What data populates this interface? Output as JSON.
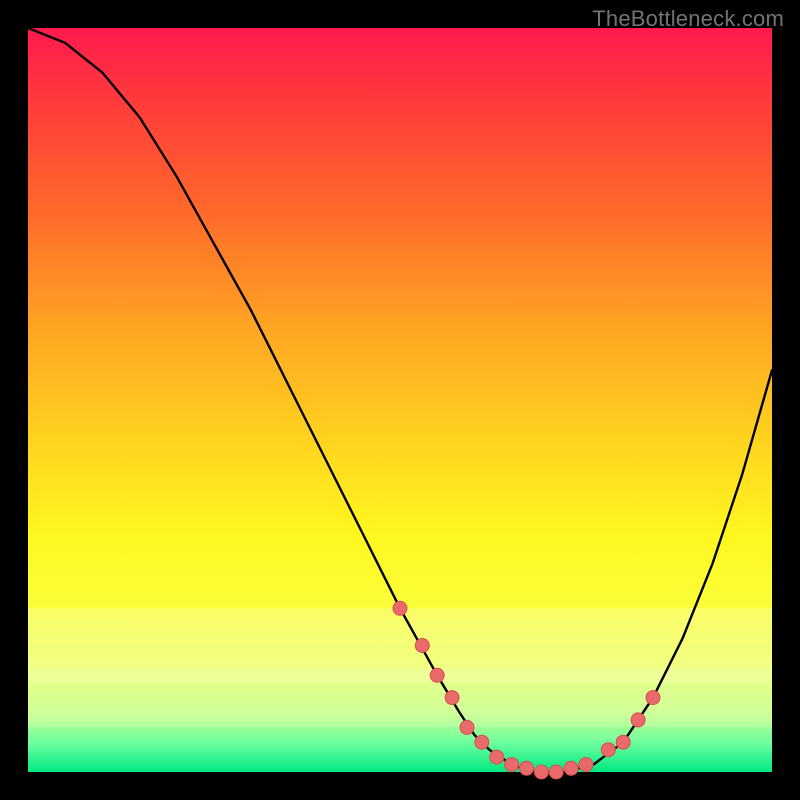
{
  "watermark": "TheBottleneck.com",
  "colors": {
    "frame": "#000000",
    "curve": "#000000",
    "marker_fill": "#e86a6a",
    "marker_stroke": "#d84f4f",
    "gradient_top": "#ff1a4d",
    "gradient_bottom": "#00e884"
  },
  "chart_data": {
    "type": "line",
    "title": "",
    "xlabel": "",
    "ylabel": "",
    "xlim": [
      0,
      100
    ],
    "ylim": [
      0,
      100
    ],
    "grid": false,
    "legend": false,
    "series": [
      {
        "name": "bottleneck-curve",
        "x": [
          0,
          5,
          10,
          15,
          20,
          25,
          30,
          35,
          40,
          45,
          50,
          55,
          58,
          60,
          62,
          65,
          68,
          72,
          76,
          80,
          84,
          88,
          92,
          96,
          100
        ],
        "values": [
          100,
          98,
          94,
          88,
          80,
          71,
          62,
          52,
          42,
          32,
          22,
          13,
          8,
          5,
          3,
          1,
          0,
          0,
          1,
          4,
          10,
          18,
          28,
          40,
          54
        ]
      }
    ],
    "markers": {
      "name": "highlighted-points",
      "shape": "circle",
      "radius_px": 7,
      "x": [
        50,
        53,
        55,
        57,
        59,
        61,
        63,
        65,
        67,
        69,
        71,
        73,
        75,
        78,
        80,
        82,
        84
      ],
      "values": [
        22,
        17,
        13,
        10,
        6,
        4,
        2,
        1,
        0.5,
        0,
        0,
        0.5,
        1,
        3,
        4,
        7,
        10
      ]
    }
  }
}
